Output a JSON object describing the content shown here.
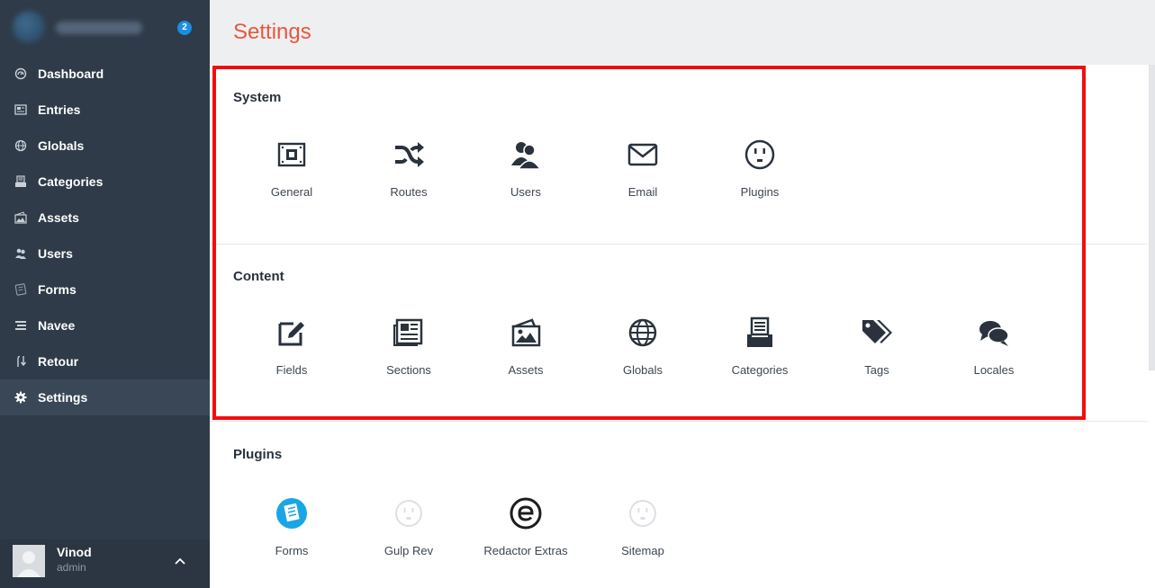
{
  "sidebar": {
    "badge": "2",
    "items": [
      {
        "label": "Dashboard",
        "icon": "dashboard-icon"
      },
      {
        "label": "Entries",
        "icon": "entries-icon"
      },
      {
        "label": "Globals",
        "icon": "globe-icon"
      },
      {
        "label": "Categories",
        "icon": "categories-icon"
      },
      {
        "label": "Assets",
        "icon": "assets-icon"
      },
      {
        "label": "Users",
        "icon": "users-icon"
      },
      {
        "label": "Forms",
        "icon": "forms-icon"
      },
      {
        "label": "Navee",
        "icon": "navee-icon"
      },
      {
        "label": "Retour",
        "icon": "retour-icon"
      },
      {
        "label": "Settings",
        "icon": "gear-icon",
        "active": true
      }
    ],
    "user": {
      "name": "Vinod",
      "role": "admin"
    }
  },
  "header": {
    "title": "Settings"
  },
  "system": {
    "title": "System",
    "items": [
      {
        "label": "General",
        "icon": "general-icon"
      },
      {
        "label": "Routes",
        "icon": "shuffle-icon"
      },
      {
        "label": "Users",
        "icon": "users-icon"
      },
      {
        "label": "Email",
        "icon": "envelope-icon"
      },
      {
        "label": "Plugins",
        "icon": "plug-icon"
      }
    ]
  },
  "content": {
    "title": "Content",
    "items": [
      {
        "label": "Fields",
        "icon": "edit-icon"
      },
      {
        "label": "Sections",
        "icon": "sections-icon"
      },
      {
        "label": "Assets",
        "icon": "assets-icon"
      },
      {
        "label": "Globals",
        "icon": "globe-icon"
      },
      {
        "label": "Categories",
        "icon": "categories-icon"
      },
      {
        "label": "Tags",
        "icon": "tags-icon"
      },
      {
        "label": "Locales",
        "icon": "chat-icon"
      }
    ]
  },
  "plugins": {
    "title": "Plugins",
    "items": [
      {
        "label": "Forms",
        "icon": "forms-plugin-icon"
      },
      {
        "label": "Gulp Rev",
        "icon": "plug-icon"
      },
      {
        "label": "Redactor Extras",
        "icon": "redactor-extras-icon"
      },
      {
        "label": "Sitemap",
        "icon": "plug-icon"
      }
    ]
  },
  "colors": {
    "accent": "#e5583f",
    "sidebar": "#2f3b48",
    "highlight": "#f20d0d",
    "badge": "#1a8fe0"
  }
}
